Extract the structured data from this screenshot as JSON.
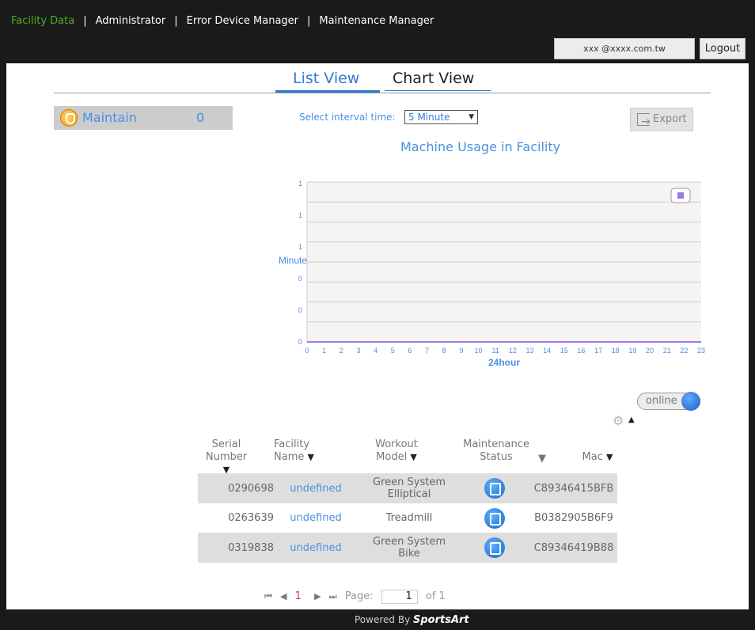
{
  "nav": {
    "items": [
      {
        "label": "Facility Data",
        "active": true
      },
      {
        "label": "Administrator",
        "active": false
      },
      {
        "label": "Error Device Manager",
        "active": false
      },
      {
        "label": "Maintenance Manager",
        "active": false
      }
    ],
    "separator": "|"
  },
  "account": {
    "email": "xxx @xxxx.com.tw",
    "logout_label": "Logout"
  },
  "tabs": {
    "list_view": "List View",
    "chart_view": "Chart View"
  },
  "maintain": {
    "label": "Maintain",
    "count": "0"
  },
  "interval": {
    "label": "Select interval time:",
    "selected": "5 Minute"
  },
  "export_label": "Export",
  "chart_data": {
    "type": "line",
    "title": "Machine Usage in Facility",
    "xlabel": "24hour",
    "ylabel": "Minute",
    "x": [
      0,
      1,
      2,
      3,
      4,
      5,
      6,
      7,
      8,
      9,
      10,
      11,
      12,
      13,
      14,
      15,
      16,
      17,
      18,
      19,
      20,
      21,
      22,
      23
    ],
    "y_tick_labels": [
      "0",
      "0",
      "0",
      "1",
      "1",
      "1"
    ],
    "series": [
      {
        "values": [
          0,
          0,
          0,
          0,
          0,
          0,
          0,
          0,
          0,
          0,
          0,
          0,
          0,
          0,
          0,
          0,
          0,
          0,
          0,
          0,
          0,
          0,
          0,
          0
        ]
      }
    ],
    "series_color": "#9b7be0",
    "legend": "top-right",
    "grid": true
  },
  "toggle": {
    "label": "online",
    "on": true
  },
  "table": {
    "headers": [
      {
        "line1": "Serial",
        "line2": "Number"
      },
      {
        "line1": "Facility",
        "line2": "Name"
      },
      {
        "line1": "Workout",
        "line2": "Model"
      },
      {
        "line1": "Maintenance",
        "line2": "Status"
      },
      {
        "line1": "",
        "line2": "Mac"
      }
    ],
    "sort_glyph": "▼",
    "rows": [
      {
        "serial": "0290698",
        "facility": "undefined",
        "model": "Green System Elliptical",
        "mac": "C89346415BFB"
      },
      {
        "serial": "0263639",
        "facility": "undefined",
        "model": "Treadmill",
        "mac": "B0382905B6F9"
      },
      {
        "serial": "0319838",
        "facility": "undefined",
        "model": "Green System Bike",
        "mac": "C89346419B88"
      }
    ]
  },
  "pager": {
    "first": "⏮",
    "prev": "◀",
    "current": "1",
    "next": "▶",
    "last": "⏭",
    "page_label": "Page:",
    "page_value": "1",
    "of_label": "of 1"
  },
  "footer": {
    "prefix": "Powered By",
    "brand": "SportsArt"
  }
}
